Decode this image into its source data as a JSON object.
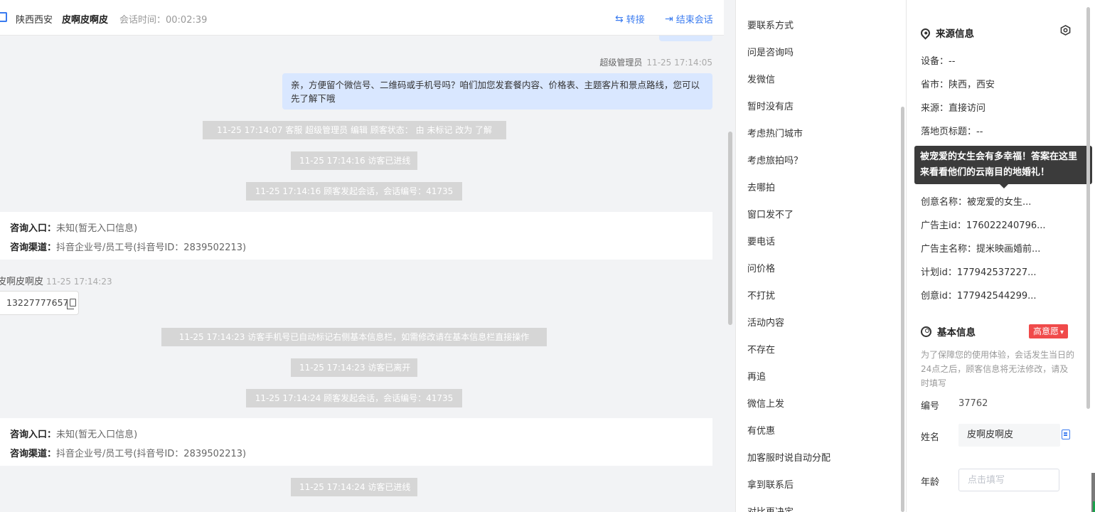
{
  "header": {
    "region": "陕西西安",
    "visitor_name": "皮啊皮啊皮",
    "session_time": "会话时间：00:02:39",
    "transfer_label": "转接",
    "end_label": "结束会话"
  },
  "messages": {
    "agent_name": "超级管理员",
    "agent_time": "11-25 17:14:05",
    "agent_text": "亲，方便留个微信号、二维码或手机号吗？咱们加您发套餐内容、价格表、主题客片和景点路线，您可以先了解下哦",
    "sys1": "11-25 17:14:07 客服 超级管理员 编辑 顾客状态： 由 未标记 改为 了解",
    "sys2": "11-25 17:14:16 访客已进线",
    "sys3": "11-25 17:14:16 顾客发起会话，会话编号：41735",
    "card1_entry_label": "咨询入口：",
    "card1_entry_value": "未知(暂无入口信息)",
    "card1_channel_label": "咨询渠道：",
    "card1_channel_value": "抖音企业号/员工号(抖音号ID：2839502213)",
    "visitor_name": "皮啊皮啊皮",
    "visitor_time": "11-25 17:14:23",
    "visitor_phone": "13227777657",
    "sys4": "11-25 17:14:23 访客手机号已自动标记右侧基本信息栏，如需修改请在基本信息栏直接操作",
    "sys5": "11-25 17:14:23 访客已离开",
    "sys6": "11-25 17:14:24 顾客发起会话，会话编号：41735",
    "card2_entry_label": "咨询入口：",
    "card2_entry_value": "未知(暂无入口信息)",
    "card2_channel_label": "咨询渠道：",
    "card2_channel_value": "抖音企业号/员工号(抖音号ID：2839502213)",
    "sys7": "11-25 17:14:24 访客已进线"
  },
  "quick_replies": [
    "要联系方式",
    "问是咨询吗",
    "发微信",
    "暂时没有店",
    "考虑热门城市",
    "考虑旅拍吗？",
    "去哪拍",
    "窗口发不了",
    "要电话",
    "问价格",
    "不打扰",
    "活动内容",
    "不存在",
    "再追",
    "微信上发",
    "有优惠",
    "加客服时说自动分配",
    "拿到联系后",
    "对比再决定"
  ],
  "source_info": {
    "title": "来源信息",
    "device": "设备：--",
    "province": "省市：陕西，西安",
    "source": "来源：直接访问",
    "landing": "落地页标题：--",
    "tooltip": "被宠爱的女生会有多幸福！答案在这里 来看看他们的云南目的地婚礼！",
    "creative_name": "创意名称：被宠爱的女生...",
    "advertiser_id": "广告主id：176022240796...",
    "advertiser_name": "广告主名称：提米映画婚前...",
    "plan_id": "计划id：177942537227...",
    "creative_id": "创意id：177942544299..."
  },
  "basic_info": {
    "title": "基本信息",
    "intent_tag": "高意愿",
    "notice": "为了保障您的使用体验，会话发生当日的24点之后，顾客信息将无法修改，请及时填写",
    "id_label": "编号",
    "id_value": "37762",
    "name_label": "姓名",
    "name_value": "皮啊皮啊皮",
    "age_label": "年龄",
    "age_placeholder": "点击填写"
  },
  "colors": {
    "accent": "#3a7bf0",
    "agent_bubble": "#d9e7ff",
    "system_pill": "#d6d6d6",
    "intent_tag": "#f04a4a"
  }
}
